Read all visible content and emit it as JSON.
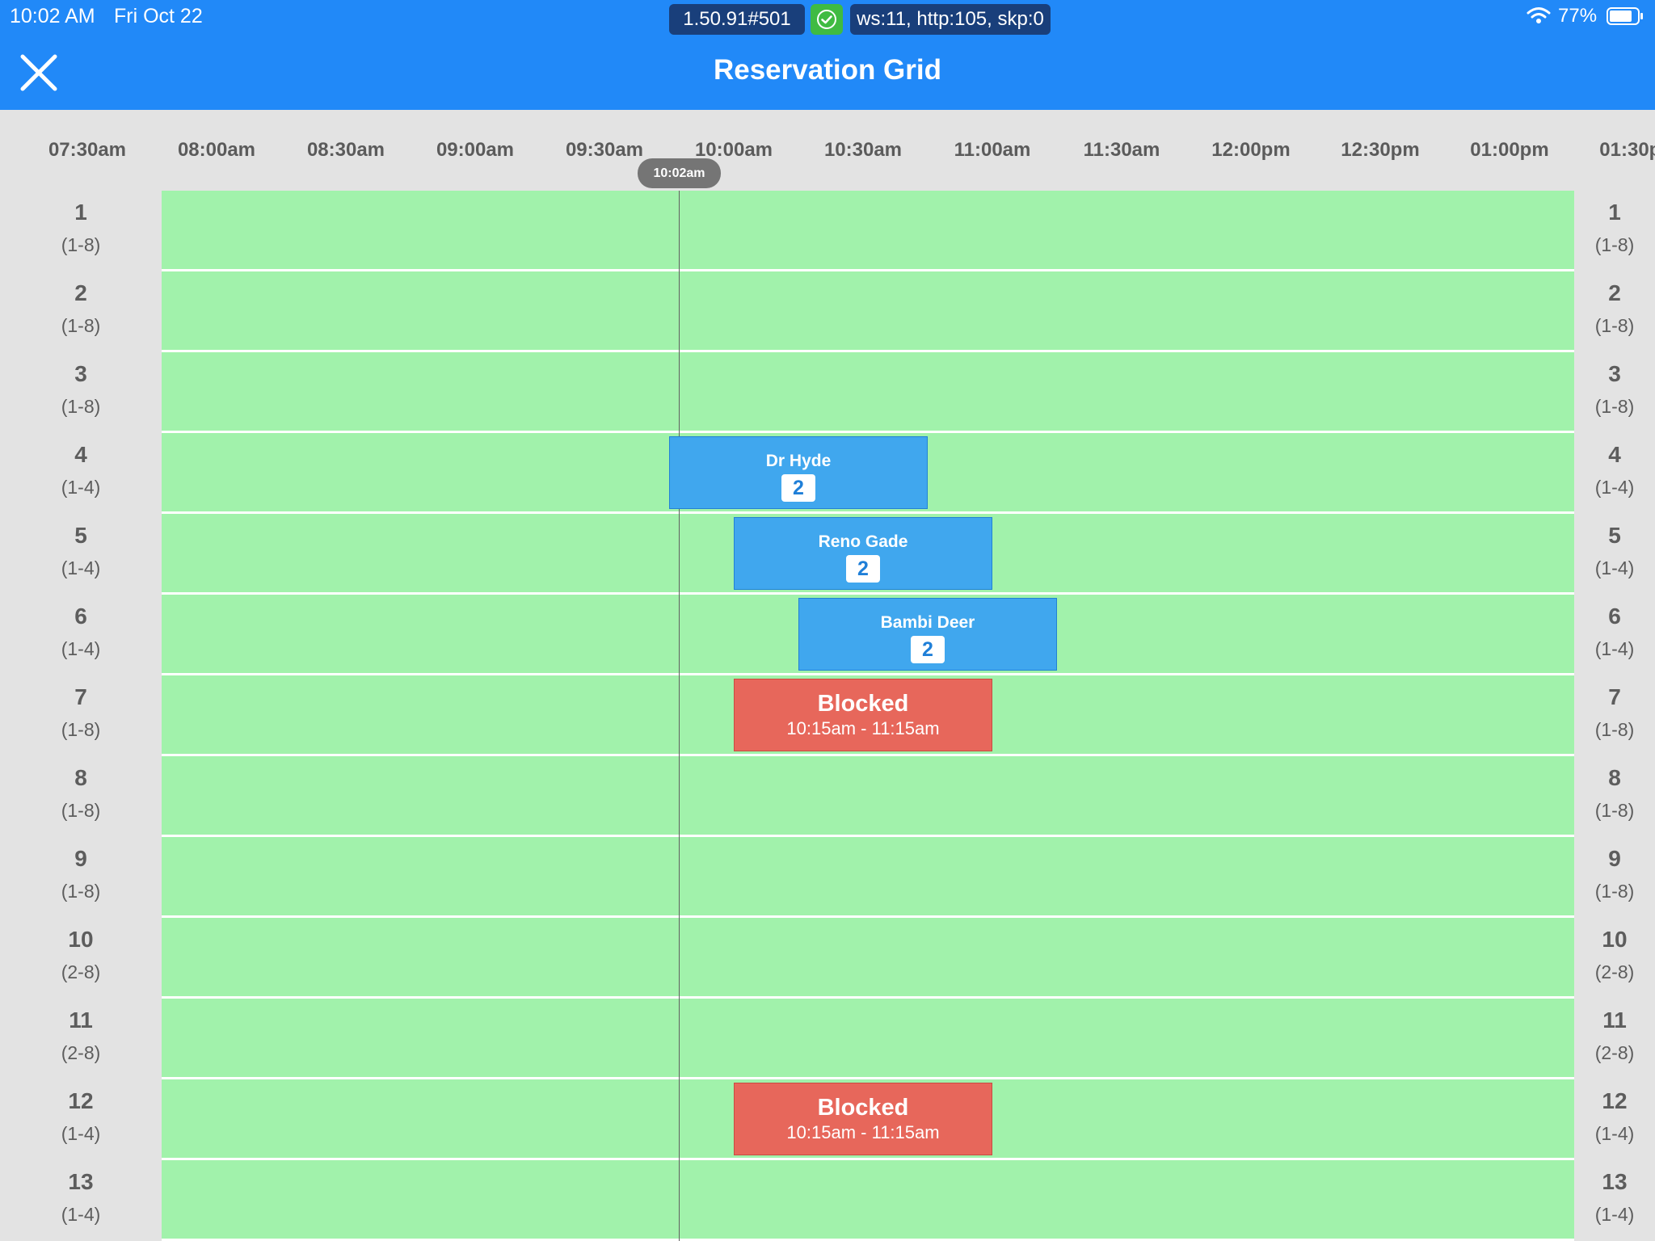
{
  "status_bar": {
    "time": "10:02 AM",
    "date": "Fri Oct 22",
    "debug_version": "1.50.91#501",
    "debug_stats": "ws:11, http:105, skp:0",
    "battery": "77%"
  },
  "header": {
    "title": "Reservation Grid"
  },
  "timeline": {
    "slots": [
      "07:30am",
      "08:00am",
      "08:30am",
      "09:00am",
      "09:30am",
      "10:00am",
      "10:30am",
      "11:00am",
      "11:30am",
      "12:00pm",
      "12:30pm",
      "01:00pm",
      "01:30pm"
    ],
    "now_label": "10:02am"
  },
  "tables": [
    {
      "number": "1",
      "capacity": "(1-8)"
    },
    {
      "number": "2",
      "capacity": "(1-8)"
    },
    {
      "number": "3",
      "capacity": "(1-8)"
    },
    {
      "number": "4",
      "capacity": "(1-4)"
    },
    {
      "number": "5",
      "capacity": "(1-4)"
    },
    {
      "number": "6",
      "capacity": "(1-4)"
    },
    {
      "number": "7",
      "capacity": "(1-8)"
    },
    {
      "number": "8",
      "capacity": "(1-8)"
    },
    {
      "number": "9",
      "capacity": "(1-8)"
    },
    {
      "number": "10",
      "capacity": "(2-8)"
    },
    {
      "number": "11",
      "capacity": "(2-8)"
    },
    {
      "number": "12",
      "capacity": "(1-4)"
    },
    {
      "number": "13",
      "capacity": "(1-4)"
    }
  ],
  "reservations": [
    {
      "table": "4",
      "name": "Dr Hyde",
      "party_size": "2"
    },
    {
      "table": "5",
      "name": "Reno Gade",
      "party_size": "2"
    },
    {
      "table": "6",
      "name": "Bambi Deer",
      "party_size": "2"
    }
  ],
  "blocks": [
    {
      "table": "7",
      "title": "Blocked",
      "time_range": "10:15am - 11:15am"
    },
    {
      "table": "12",
      "title": "Blocked",
      "time_range": "10:15am - 11:15am"
    }
  ],
  "colors": {
    "header_blue": "#2189f8",
    "available_green": "#a1f2ab",
    "reservation_blue": "#40a7ee",
    "blocked_red": "#e7675b"
  }
}
